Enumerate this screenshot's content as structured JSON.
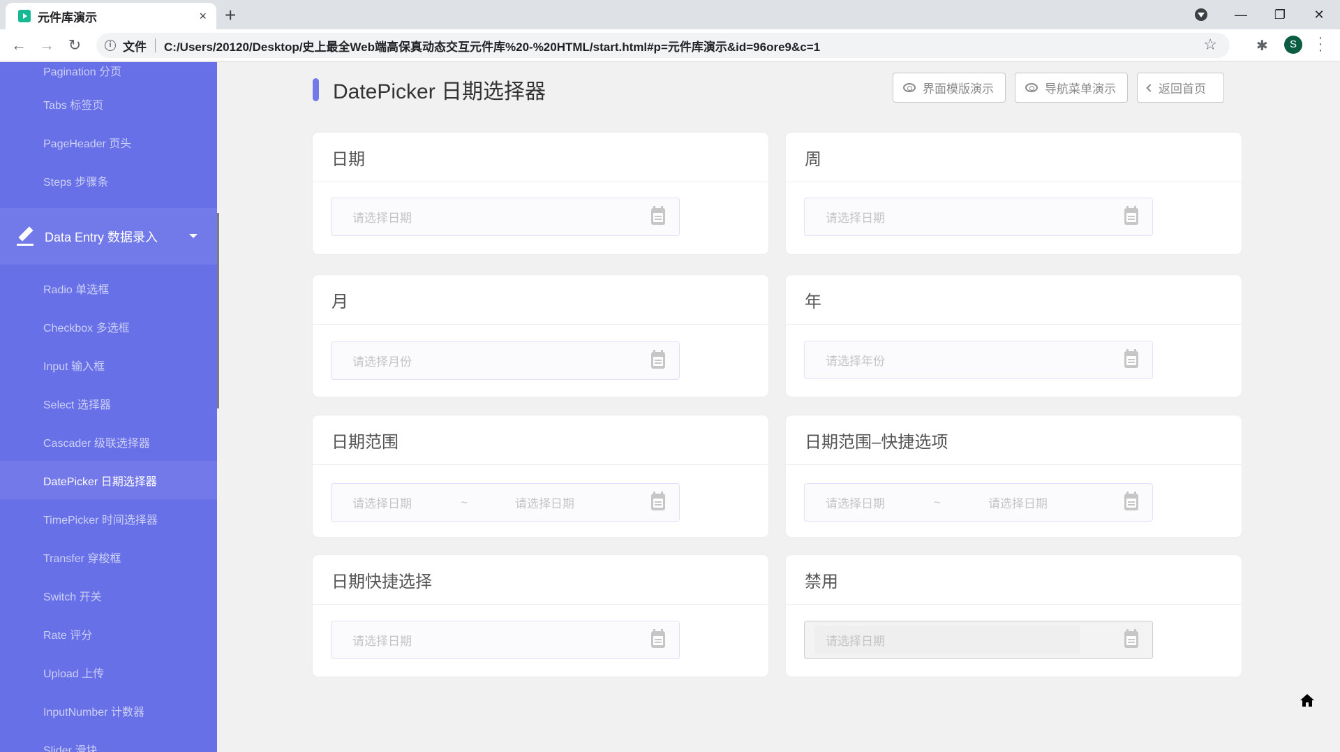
{
  "browser": {
    "tab_title": "元件库演示",
    "tab_close": "×",
    "new_tab": "+",
    "scheme_label": "文件",
    "url": "C:/Users/20120/Desktop/史上最全Web端高保真动态交互元件库%20-%20HTML/start.html#p=元件库演示&id=96ore9&c=1",
    "avatar_letter": "S",
    "icons": {
      "back": "←",
      "forward": "→",
      "reload": "↻",
      "info": "i",
      "star": "☆",
      "extensions": "✱",
      "menu": "⋮",
      "minimize": "—",
      "restore": "❐",
      "close": "✕"
    }
  },
  "sidebar": {
    "items_before": [
      {
        "label": "Pagination 分页"
      },
      {
        "label": "Tabs 标签页"
      },
      {
        "label": "PageHeader 页头"
      },
      {
        "label": "Steps 步骤条"
      }
    ],
    "group": {
      "label": "Data Entry 数据录入",
      "expanded": true
    },
    "items_after": [
      {
        "label": "Radio 单选框"
      },
      {
        "label": "Checkbox 多选框"
      },
      {
        "label": "Input 输入框"
      },
      {
        "label": "Select 选择器"
      },
      {
        "label": "Cascader 级联选择器"
      },
      {
        "label": "DatePicker 日期选择器",
        "active": true
      },
      {
        "label": "TimePicker 时间选择器"
      },
      {
        "label": "Transfer 穿梭框"
      },
      {
        "label": "Switch 开关"
      },
      {
        "label": "Rate 评分"
      },
      {
        "label": "Upload 上传"
      },
      {
        "label": "InputNumber 计数器"
      },
      {
        "label": "Slider 滑块"
      }
    ]
  },
  "header": {
    "title": "DatePicker 日期选择器",
    "buttons": [
      {
        "label": "界面模版演示",
        "icon": "eye-icon"
      },
      {
        "label": "导航菜单演示",
        "icon": "eye-icon"
      },
      {
        "label": "返回首页",
        "icon": "chevron-left-icon"
      }
    ]
  },
  "cards": [
    {
      "title": "日期",
      "type": "single",
      "placeholder": "请选择日期"
    },
    {
      "title": "周",
      "type": "single",
      "placeholder": "请选择日期"
    },
    {
      "title": "月",
      "type": "single",
      "placeholder": "请选择月份"
    },
    {
      "title": "年",
      "type": "single",
      "placeholder": "请选择年份"
    },
    {
      "title": "日期范围",
      "type": "range",
      "start_placeholder": "请选择日期",
      "separator": "~",
      "end_placeholder": "请选择日期"
    },
    {
      "title": "日期范围–快捷选项",
      "type": "range",
      "start_placeholder": "请选择日期",
      "separator": "~",
      "end_placeholder": "请选择日期"
    },
    {
      "title": "日期快捷选择",
      "type": "single",
      "placeholder": "请选择日期"
    },
    {
      "title": "禁用",
      "type": "single",
      "placeholder": "请选择日期",
      "disabled": true
    }
  ],
  "colors": {
    "sidebar_bg": "#6770e6",
    "accent": "#7479ea",
    "page_bg": "#f1f1f1"
  }
}
